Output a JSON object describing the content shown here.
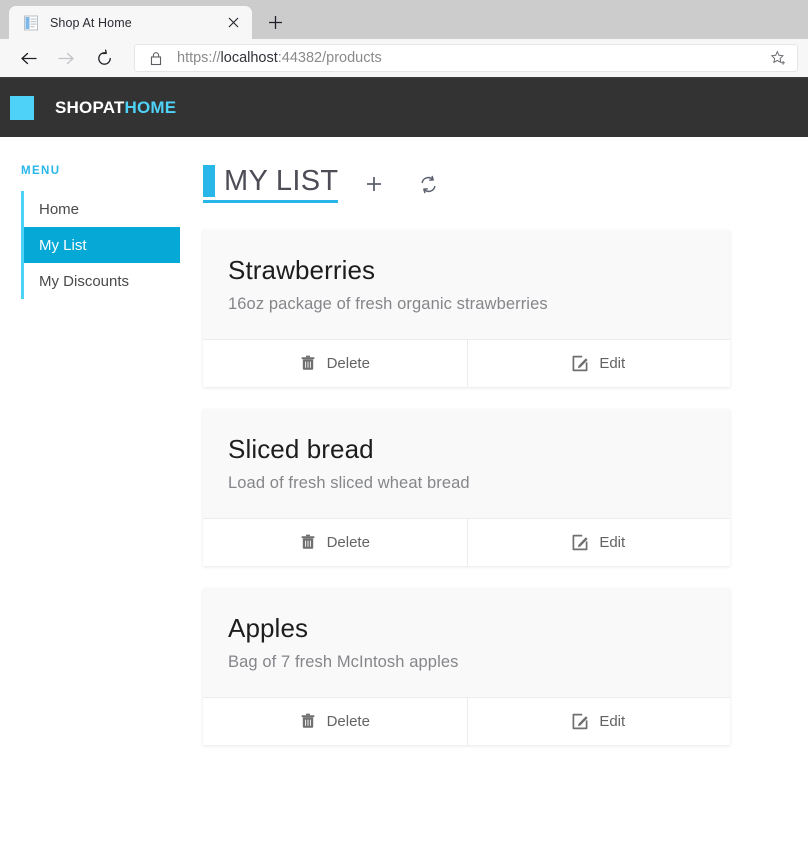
{
  "browser": {
    "tab": {
      "title": "Shop At Home",
      "favicon_icon": "page-document-icon",
      "close_icon": "close-icon"
    },
    "newtab_icon": "plus-icon",
    "nav": {
      "back_icon": "back-arrow-icon",
      "forward_icon": "forward-arrow-icon",
      "reload_icon": "reload-icon"
    },
    "address": {
      "lock_icon": "lock-icon",
      "scheme": "https://",
      "host": "localhost",
      "path": ":44382/products",
      "full_url": "https://localhost:44382/products",
      "favorite_icon": "star-add-icon"
    }
  },
  "site": {
    "brand_primary": "SHOPAT",
    "brand_accent": "HOME",
    "header_bg": "#333333",
    "accent_color": "#4fd2f7",
    "active_color": "#06a9d6"
  },
  "sidebar": {
    "label": "MENU",
    "items": [
      {
        "label": "Home",
        "active": false
      },
      {
        "label": "My List",
        "active": true
      },
      {
        "label": "My Discounts",
        "active": false
      }
    ]
  },
  "main": {
    "title": "MY LIST",
    "actions": [
      {
        "name": "add-item-button",
        "icon": "plus-icon"
      },
      {
        "name": "refresh-list-button",
        "icon": "refresh-sync-icon"
      }
    ],
    "cards": [
      {
        "title": "Strawberries",
        "description": "16oz package of fresh organic strawberries",
        "delete_label": "Delete",
        "edit_label": "Edit"
      },
      {
        "title": "Sliced bread",
        "description": "Load of fresh sliced wheat bread",
        "delete_label": "Delete",
        "edit_label": "Edit"
      },
      {
        "title": "Apples",
        "description": "Bag of 7 fresh McIntosh apples",
        "delete_label": "Delete",
        "edit_label": "Edit"
      }
    ]
  }
}
